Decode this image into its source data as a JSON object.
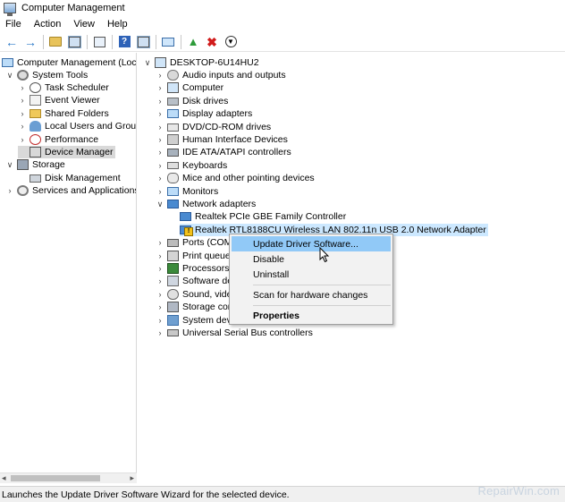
{
  "window": {
    "title": "Computer Management"
  },
  "menu": [
    "File",
    "Action",
    "View",
    "Help"
  ],
  "toolbar": {
    "buttons": [
      "back-arrow-icon",
      "forward-arrow-icon",
      "up-folder-icon",
      "show-hide-tree-icon",
      "properties-icon",
      "help-icon",
      "console-tree-icon",
      "monitor-icon",
      "update-driver-icon",
      "uninstall-icon",
      "disable-device-icon"
    ]
  },
  "left_tree": {
    "root": "Computer Management (Local",
    "items": [
      {
        "label": "System Tools",
        "icon": "gear-icon"
      },
      {
        "label": "Task Scheduler",
        "icon": "clock-icon"
      },
      {
        "label": "Event Viewer",
        "icon": "event-log-icon"
      },
      {
        "label": "Shared Folders",
        "icon": "folder-icon"
      },
      {
        "label": "Local Users and Groups",
        "icon": "users-icon"
      },
      {
        "label": "Performance",
        "icon": "performance-icon"
      },
      {
        "label": "Device Manager",
        "icon": "device-manager-icon"
      },
      {
        "label": "Storage",
        "icon": "storage-icon"
      },
      {
        "label": "Disk Management",
        "icon": "disk-icon"
      },
      {
        "label": "Services and Applications",
        "icon": "services-icon"
      }
    ]
  },
  "device_tree": {
    "root": "DESKTOP-6U14HU2",
    "categories": [
      "Audio inputs and outputs",
      "Computer",
      "Disk drives",
      "Display adapters",
      "DVD/CD-ROM drives",
      "Human Interface Devices",
      "IDE ATA/ATAPI controllers",
      "Keyboards",
      "Mice and other pointing devices",
      "Monitors",
      "Network adapters",
      "Realtek PCIe GBE Family Controller",
      "Realtek RTL8188CU Wireless LAN 802.11n USB 2.0 Network Adapter",
      "Ports (COM",
      "Print queue",
      "Processors",
      "Software de",
      "Sound, vide",
      "Storage cor",
      "System devi",
      "Universal Serial Bus controllers"
    ]
  },
  "context_menu": {
    "items": [
      "Update Driver Software...",
      "Disable",
      "Uninstall",
      "Scan for hardware changes",
      "Properties"
    ]
  },
  "status_bar": "Launches the Update Driver Software Wizard for the selected device.",
  "watermark": "RepairWin.com"
}
